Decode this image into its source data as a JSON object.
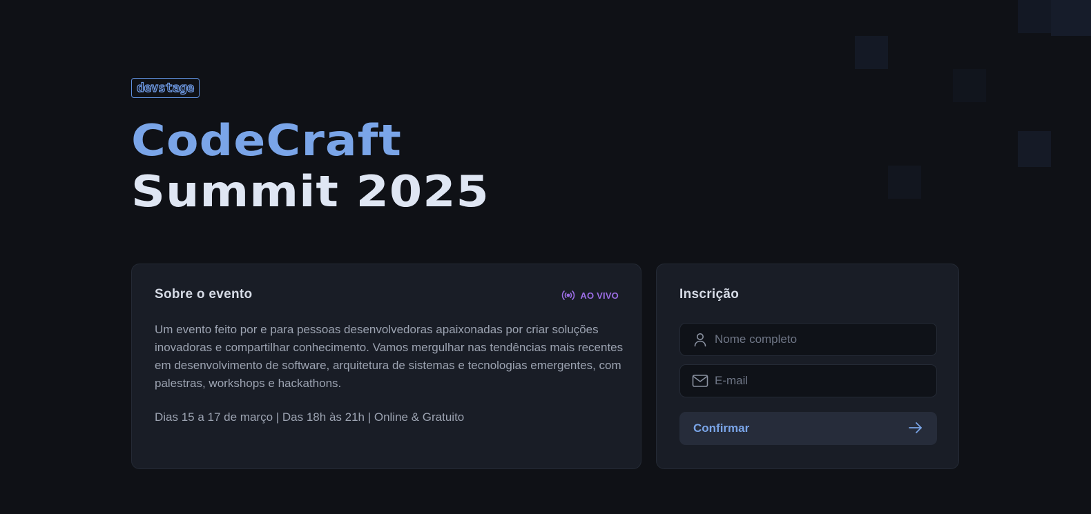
{
  "brand": {
    "logo_text": "devstage"
  },
  "hero": {
    "line1": "CodeCraft",
    "line2": "Summit 2025"
  },
  "about": {
    "title": "Sobre o evento",
    "live_label": "AO VIVO",
    "description": "Um evento feito por e para pessoas desenvolvedoras apaixonadas por criar soluções inovadoras e compartilhar conhecimento. Vamos mergulhar nas tendências mais recentes em desenvolvimento de software, arquitetura de sistemas e tecnologias emergentes, com palestras, workshops e hackathons.",
    "info": "Dias 15 a 17 de março | Das 18h às 21h | Online & Gratuito"
  },
  "signup": {
    "title": "Inscrição",
    "name_placeholder": "Nome completo",
    "name_value": "",
    "email_placeholder": "E-mail",
    "email_value": "",
    "confirm_label": "Confirmar"
  },
  "icons": {
    "live": "radio-signal-icon",
    "name": "user-icon",
    "email": "mail-icon",
    "confirm": "arrow-right-icon"
  },
  "colors": {
    "background": "#0f1116",
    "card": "#191d26",
    "accent_blue": "#7aa5e8",
    "live_purple": "#9b6de4",
    "muted_text": "#9ca3b1"
  }
}
